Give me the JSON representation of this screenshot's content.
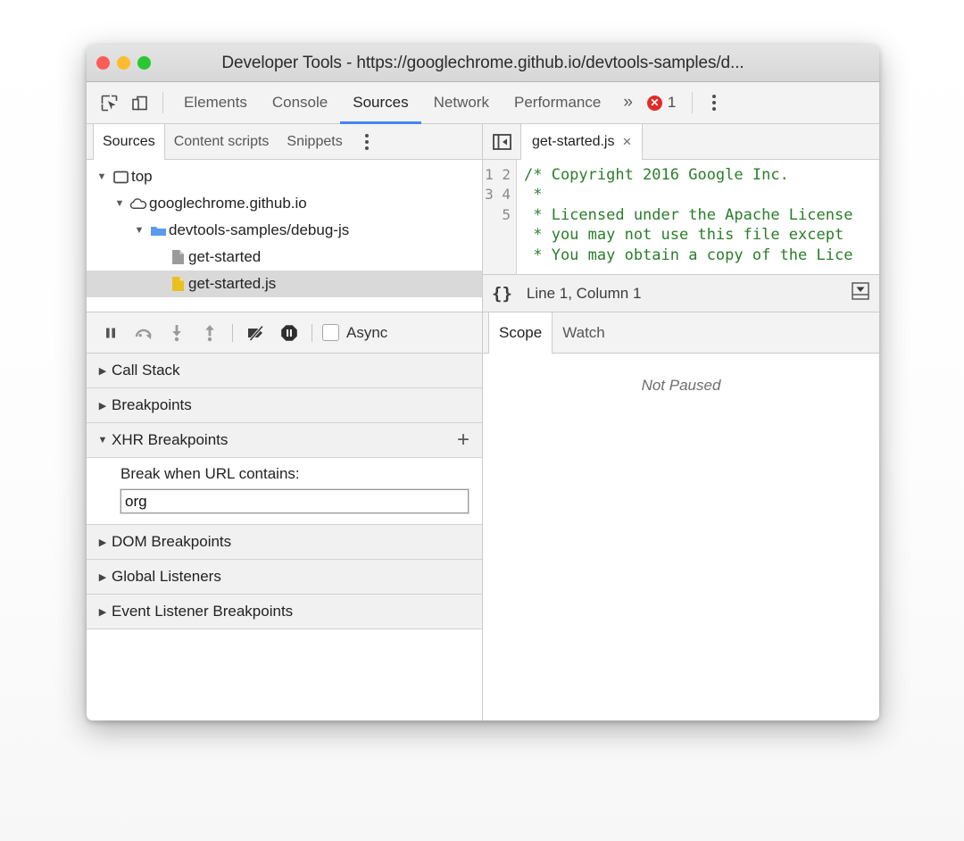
{
  "window": {
    "title": "Developer Tools - https://googlechrome.github.io/devtools-samples/d...",
    "traffic_lights": {
      "close": "close-light",
      "minimize": "minimize-light",
      "zoom": "zoom-light"
    },
    "colors": {
      "close": "#fc5e57",
      "minimize": "#fdbc2e",
      "zoom": "#29c732",
      "accent": "#4285f4",
      "error": "#df2c28",
      "code_green": "#2a7d2a",
      "js_icon": "#e8c022",
      "folder_icon": "#5b9bee",
      "selection": "#d9d9d9"
    }
  },
  "devtools_toolbar": {
    "inspect_icon": "inspect-element-icon",
    "device_icon": "device-toolbar-icon",
    "tabs": [
      {
        "label": "Elements",
        "active": false
      },
      {
        "label": "Console",
        "active": false
      },
      {
        "label": "Sources",
        "active": true
      },
      {
        "label": "Network",
        "active": false
      },
      {
        "label": "Performance",
        "active": false
      }
    ],
    "more_tabs": "»",
    "error_mark": "✕",
    "error_count": "1",
    "menu_icon": "kebab-menu-icon"
  },
  "navigator": {
    "tabs": [
      {
        "label": "Sources",
        "active": true
      },
      {
        "label": "Content scripts",
        "active": false
      },
      {
        "label": "Snippets",
        "active": false
      }
    ],
    "menu_icon": "kebab-menu-icon",
    "tree": [
      {
        "label": "top",
        "icon": "frame-icon",
        "twisty": "▼",
        "indent": 8,
        "selected": false
      },
      {
        "label": "googlechrome.github.io",
        "icon": "cloud-icon",
        "twisty": "▼",
        "indent": 28,
        "selected": false
      },
      {
        "label": "devtools-samples/debug-js",
        "icon": "folder-icon",
        "twisty": "▼",
        "indent": 50,
        "selected": false
      },
      {
        "label": "get-started",
        "icon": "document-icon",
        "twisty": "",
        "indent": 72,
        "selected": false
      },
      {
        "label": "get-started.js",
        "icon": "js-file-icon",
        "twisty": "",
        "indent": 72,
        "selected": true
      }
    ]
  },
  "debugger_toolbar": {
    "buttons": [
      {
        "name": "resume-pause-button",
        "icon": "pause-icon"
      },
      {
        "name": "step-over-button",
        "icon": "step-over-icon"
      },
      {
        "name": "step-into-button",
        "icon": "step-into-icon"
      },
      {
        "name": "step-out-button",
        "icon": "step-out-icon"
      },
      {
        "name": "deactivate-breakpoints-button",
        "icon": "deactivate-breakpoints-icon"
      },
      {
        "name": "pause-on-exceptions-button",
        "icon": "pause-on-exceptions-icon"
      }
    ],
    "async_label": "Async",
    "async_checked": false
  },
  "sidebar_panes": [
    {
      "label": "Call Stack",
      "expanded": false,
      "twisty": "▶"
    },
    {
      "label": "Breakpoints",
      "expanded": false,
      "twisty": "▶"
    },
    {
      "label": "XHR Breakpoints",
      "expanded": true,
      "twisty": "▼",
      "add_label": "+"
    },
    {
      "label": "DOM Breakpoints",
      "expanded": false,
      "twisty": "▶"
    },
    {
      "label": "Global Listeners",
      "expanded": false,
      "twisty": "▶"
    },
    {
      "label": "Event Listener Breakpoints",
      "expanded": false,
      "twisty": "▶"
    }
  ],
  "xhr_breakpoints": {
    "prompt": "Break when URL contains:",
    "input_value": "org",
    "input_placeholder": ""
  },
  "editor": {
    "panel_toggle_icon": "show-navigator-icon",
    "tab_label": "get-started.js",
    "tab_close": "×",
    "line_numbers": "1\n2\n3\n4\n5",
    "code": "/* Copyright 2016 Google Inc.\n *\n * Licensed under the Apache License\n * you may not use this file except\n * You may obtain a copy of the Lice",
    "status_format_icon": "{}",
    "status_text": "Line 1, Column 1",
    "status_more_icon": "more-options-icon"
  },
  "scope_panel": {
    "tabs": [
      {
        "label": "Scope",
        "active": true
      },
      {
        "label": "Watch",
        "active": false
      }
    ],
    "empty_message": "Not Paused"
  }
}
